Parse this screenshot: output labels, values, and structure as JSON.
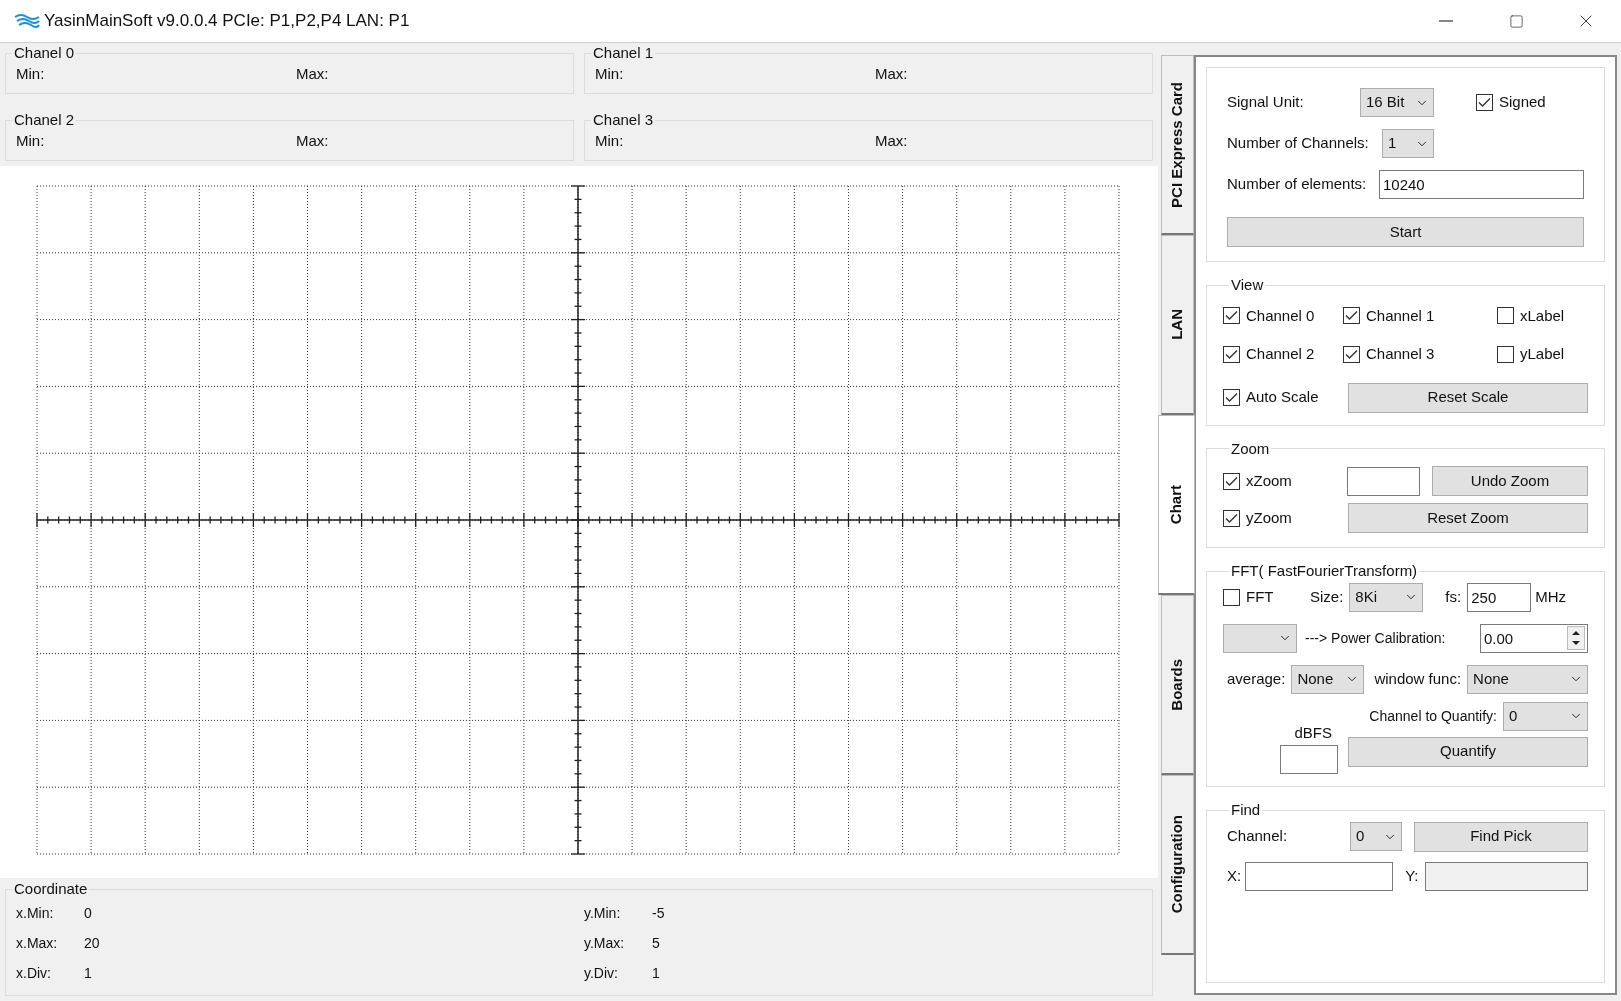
{
  "window": {
    "title": "YasinMainSoft v9.0.0.4 PCIe: P1,P2,P4 LAN: P1"
  },
  "channel_panels": [
    {
      "title": "Chanel 0",
      "min_label": "Min:",
      "max_label": "Max:"
    },
    {
      "title": "Chanel 1",
      "min_label": "Min:",
      "max_label": "Max:"
    },
    {
      "title": "Chanel 2",
      "min_label": "Min:",
      "max_label": "Max:"
    },
    {
      "title": "Chanel 3",
      "min_label": "Min:",
      "max_label": "Max:"
    }
  ],
  "coordinate": {
    "title": "Coordinate",
    "x_rows": [
      {
        "label": "x.Min:",
        "value": "0"
      },
      {
        "label": "x.Max:",
        "value": "20"
      },
      {
        "label": "x.Div:",
        "value": "1"
      }
    ],
    "y_rows": [
      {
        "label": "y.Min:",
        "value": "-5"
      },
      {
        "label": "y.Max:",
        "value": "5"
      },
      {
        "label": "y.Div:",
        "value": "1"
      }
    ]
  },
  "side_tabs": [
    {
      "label": "PCI Express Card",
      "selected": false
    },
    {
      "label": "LAN",
      "selected": false
    },
    {
      "label": "Chart",
      "selected": true
    },
    {
      "label": "Boards",
      "selected": false
    },
    {
      "label": "Configuration",
      "selected": false
    }
  ],
  "acquisition": {
    "signal_unit_label": "Signal Unit:",
    "signal_unit_value": "16 Bit",
    "signed": {
      "label": "Signed",
      "checked": true
    },
    "channels_label": "Number of Channels:",
    "channels_value": "1",
    "elements_label": "Number of elements:",
    "elements_value": "10240",
    "start_button": "Start"
  },
  "view": {
    "title": "View",
    "checkboxes": [
      {
        "label": "Channel 0",
        "checked": true
      },
      {
        "label": "Channel 1",
        "checked": true
      },
      {
        "label": "xLabel",
        "checked": false
      },
      {
        "label": "Channel 2",
        "checked": true
      },
      {
        "label": "Channel 3",
        "checked": true
      },
      {
        "label": "yLabel",
        "checked": false
      }
    ],
    "auto_scale": {
      "label": "Auto Scale",
      "checked": true
    },
    "reset_scale_button": "Reset Scale"
  },
  "zoom": {
    "title": "Zoom",
    "x_zoom": {
      "label": "xZoom",
      "checked": true
    },
    "undo_button": "Undo Zoom",
    "y_zoom": {
      "label": "yZoom",
      "checked": true
    },
    "reset_button": "Reset Zoom"
  },
  "fft": {
    "title": "FFT( FastFourierTransform)",
    "fft_checkbox": {
      "label": "FFT",
      "checked": false
    },
    "size_label": "Size:",
    "size_value": "8Ki",
    "fs_label": "fs:",
    "fs_value": "250",
    "fs_unit": "MHz",
    "power_label": "---> Power Calibration:",
    "power_value": "0.00",
    "average_label": "average:",
    "average_value": "None",
    "window_label": "window func:",
    "window_value": "None",
    "dbfs_label": "dBFS",
    "quantify_channel_label": "Channel to Quantify:",
    "quantify_channel_value": "0",
    "quantify_button": "Quantify"
  },
  "find": {
    "title": "Find",
    "channel_label": "Channel:",
    "channel_value": "0",
    "find_button": "Find Pick",
    "x_label": "X:",
    "y_label": "Y:",
    "y_disabled": true
  }
}
